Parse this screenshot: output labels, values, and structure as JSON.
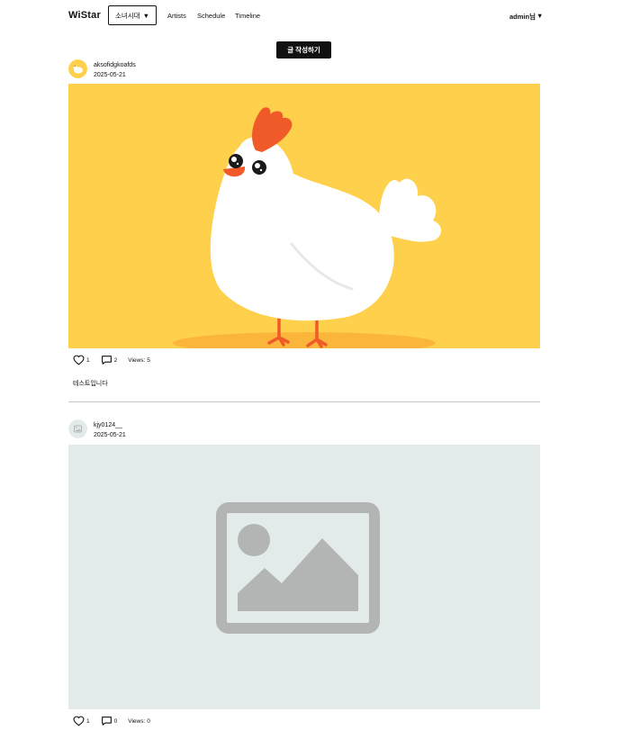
{
  "header": {
    "logo": "WiStar",
    "artist_select": {
      "value": "소녀시대",
      "arrow": "▼"
    },
    "nav": [
      "Artists",
      "Schedule",
      "Timeline"
    ],
    "user": {
      "label": "admin님",
      "arrow": "▼"
    }
  },
  "write_button": {
    "label": "글 작성하기"
  },
  "posts": [
    {
      "author": "aksofidgkoafds",
      "date": "2025-05-21",
      "image_icon": "chicken-illustration",
      "likes": "1",
      "comments": "2",
      "views_label": "Views:",
      "views": "5",
      "text": "테스트입니다"
    },
    {
      "author": "kjy0124__",
      "date": "2025-05-21",
      "image_icon": "image-placeholder-icon",
      "likes": "1",
      "comments": "0",
      "views_label": "Views:",
      "views": "0"
    }
  ],
  "colors": {
    "accent": "#111111",
    "post1_image_bg": "#ffd04c",
    "post2_image_bg": "#e3ebea",
    "placeholder_icon": "#b3b5b5"
  }
}
